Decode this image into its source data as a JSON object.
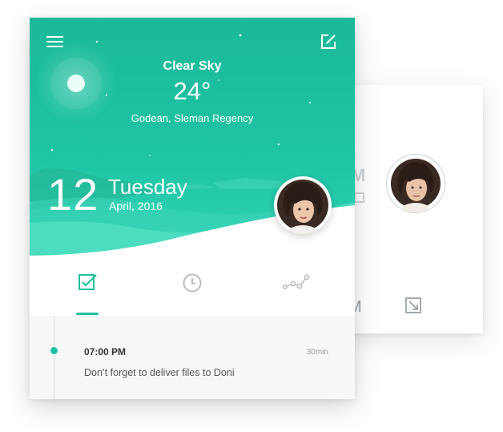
{
  "weather": {
    "condition": "Clear Sky",
    "temperature": "24°",
    "location": "Godean, Sleman Regency"
  },
  "date": {
    "day_number": "12",
    "weekday": "Tuesday",
    "month_year": "April, 2016"
  },
  "tabs": [
    {
      "icon": "task-check-icon",
      "active": true
    },
    {
      "icon": "clock-icon",
      "active": false
    },
    {
      "icon": "stats-line-icon",
      "active": false
    }
  ],
  "tasks": [
    {
      "time": "07:00 PM",
      "duration": "30min",
      "text": "Don’t forget to deliver files to Doni"
    }
  ],
  "colors": {
    "accent": "#1fc0a0",
    "hero_top": "#1bb99a",
    "hero_bottom": "#2fd3b5",
    "text_dark": "#333333",
    "text_muted": "#9b9b9b"
  }
}
